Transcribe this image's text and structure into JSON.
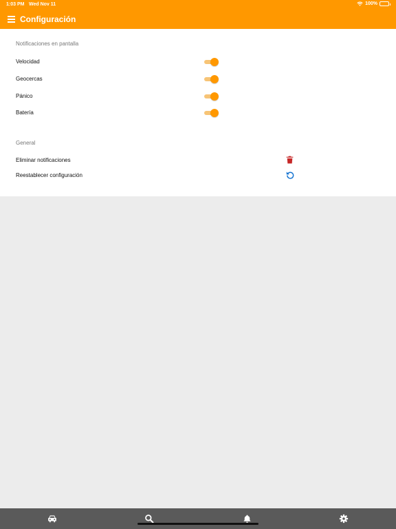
{
  "status_bar": {
    "time": "1:03 PM",
    "date": "Wed Nov 11",
    "battery": "100%",
    "icons": [
      "wifi-icon",
      "battery-icon"
    ]
  },
  "header": {
    "title": "Configuración",
    "menu_icon": "menu-icon",
    "background": "#ff9800"
  },
  "notifications": {
    "section_title": "Notificaciones en pantalla",
    "items": [
      {
        "label": "Velocidad",
        "enabled": true
      },
      {
        "label": "Geocercas",
        "enabled": true
      },
      {
        "label": "Pánico",
        "enabled": true
      },
      {
        "label": "Batería",
        "enabled": true
      }
    ]
  },
  "general": {
    "section_title": "General",
    "items": [
      {
        "label": "Eliminar notificaciones",
        "icon": "trash-icon",
        "icon_color": "#c62828"
      },
      {
        "label": "Reestablecer configuración",
        "icon": "reset-icon",
        "icon_color": "#1976d2"
      }
    ]
  },
  "tabbar": {
    "tabs": [
      "car-icon",
      "search-icon",
      "bell-icon",
      "gear-icon"
    ],
    "background": "#5a5a5a"
  }
}
